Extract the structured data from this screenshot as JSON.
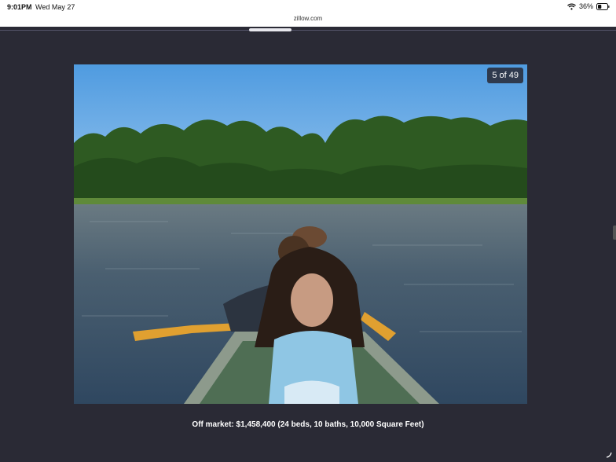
{
  "status": {
    "time": "9:01PM",
    "date": "Wed May 27",
    "battery": "36%",
    "wifi_icon": "wifi-icon",
    "battery_icon": "battery-icon"
  },
  "browser": {
    "url": "zillow.com"
  },
  "gallery": {
    "counter": "5 of 49",
    "caption": "Off market: $1,458,400 (24 beds, 10 baths, 10,000 Square Feet)"
  },
  "colors": {
    "background": "#2a2a35",
    "status_bar": "#ffffff"
  }
}
